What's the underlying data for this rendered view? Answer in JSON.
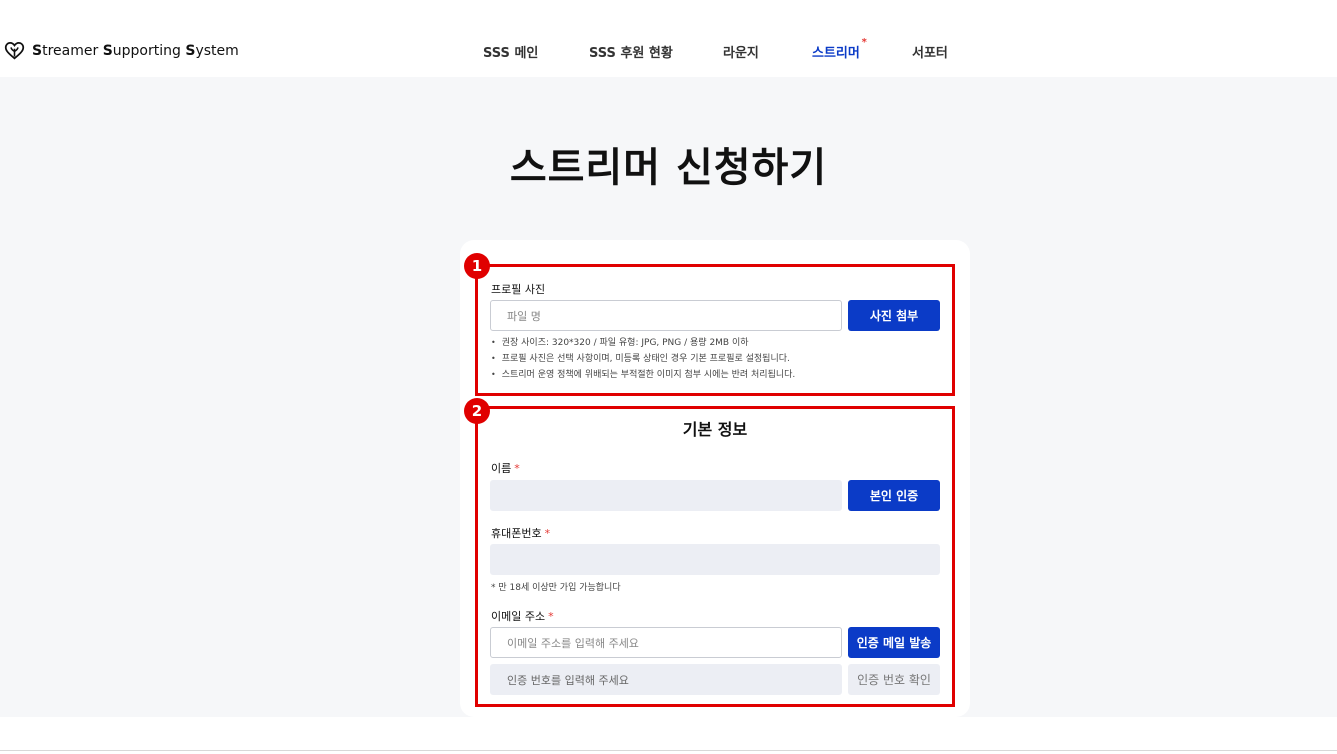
{
  "header": {
    "logo": {
      "icon": "heart-leaf-icon",
      "parts": [
        {
          "bold": "S",
          "rest": "treamer "
        },
        {
          "bold": "S",
          "rest": "upporting "
        },
        {
          "bold": "S",
          "rest": "ystem"
        }
      ]
    },
    "nav": [
      {
        "label": "SSS 메인"
      },
      {
        "label": "SSS 후원 현황"
      },
      {
        "label": "라운지"
      },
      {
        "label": "스트리머",
        "marker": "*"
      },
      {
        "label": "서포터"
      }
    ]
  },
  "page": {
    "title": "스트리머 신청하기"
  },
  "annotations": {
    "badge1": "1",
    "badge2": "2"
  },
  "profile": {
    "label": "프로필 사진",
    "file_placeholder": "파일 명",
    "attach_button": "사진 첨부",
    "notes": [
      "권장 사이즈: 320*320 / 파일 유형: JPG, PNG / 용량 2MB 이하",
      "프로필 사진은 선택 사항이며, 미등록 상태인 경우 기본 프로필로 설정됩니다.",
      "스트리머 운영 정책에 위배되는 부적절한 이미지 첨부 시에는 반려 처리됩니다."
    ]
  },
  "basic": {
    "title": "기본 정보",
    "required_marker": "*",
    "name_label": "이름",
    "verify_button": "본인 인증",
    "phone_label": "휴대폰번호",
    "age_hint": "* 만 18세 이상만 가입 가능합니다",
    "email_label": "이메일 주소",
    "email_placeholder": "이메일 주소를 입력해 주세요",
    "send_mail_button": "인증 메일 발송",
    "code_placeholder": "인증 번호를 입력해 주세요",
    "confirm_code_button": "인증 번호 확인"
  },
  "colors": {
    "primary": "#0b3bc7",
    "annotation": "#e00000",
    "required": "#e53935"
  }
}
